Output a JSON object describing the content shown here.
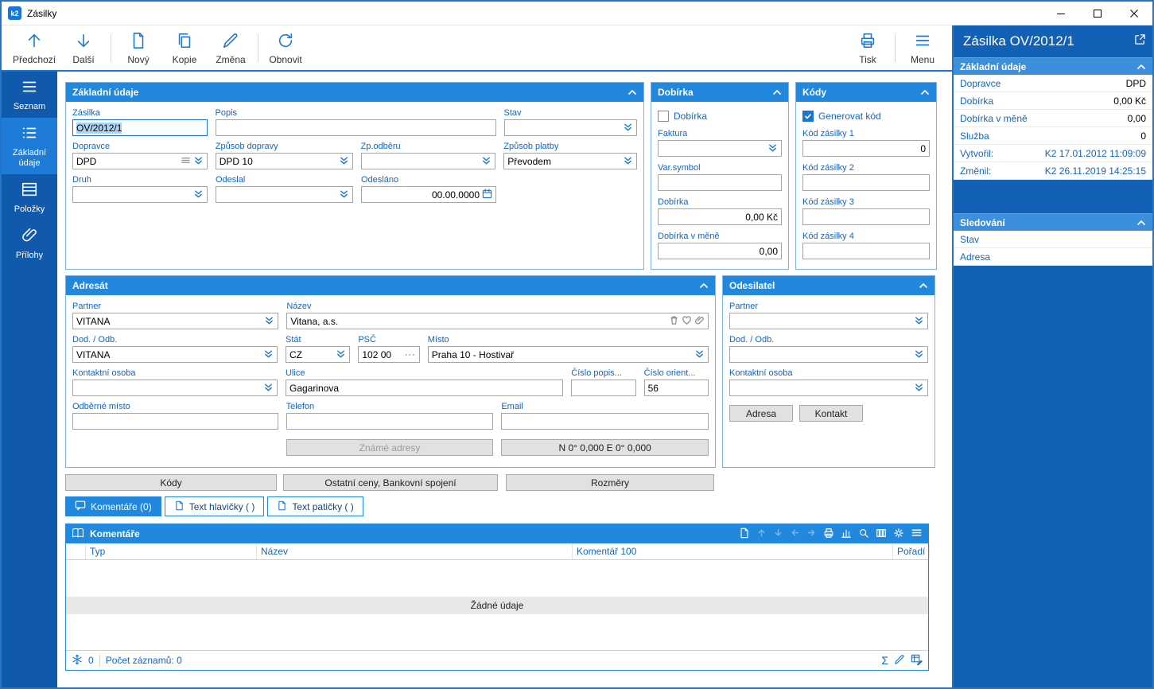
{
  "window": {
    "title": "Zásilky",
    "app_badge": "k2"
  },
  "toolbar": {
    "prev": "Předchozí",
    "next": "Další",
    "new": "Nový",
    "copy": "Kopie",
    "change": "Změna",
    "refresh": "Obnovit",
    "print": "Tisk",
    "menu": "Menu"
  },
  "sidebar": {
    "items": [
      {
        "label": "Seznam"
      },
      {
        "label": "Základní údaje"
      },
      {
        "label": "Položky"
      },
      {
        "label": "Přílohy"
      }
    ]
  },
  "panels": {
    "basic": {
      "title": "Základní údaje",
      "zasilka_label": "Zásilka",
      "zasilka_value": "OV/2012/1",
      "popis_label": "Popis",
      "stav_label": "Stav",
      "dopravce_label": "Dopravce",
      "dopravce_value": "DPD",
      "zpusob_dopravy_label": "Způsob dopravy",
      "zpusob_dopravy_value": "DPD 10",
      "zp_odberu_label": "Zp.odběru",
      "zpusob_platby_label": "Způsob platby",
      "zpusob_platby_value": "Převodem",
      "druh_label": "Druh",
      "odeslal_label": "Odeslal",
      "odeslano_label": "Odesláno",
      "odeslano_value": "00.00.0000"
    },
    "dobirka": {
      "title": "Dobírka",
      "checkbox_label": "Dobírka",
      "faktura_label": "Faktura",
      "var_symbol_label": "Var.symbol",
      "dobirka_label": "Dobírka",
      "dobirka_value": "0,00 Kč",
      "dobirka_v_mene_label": "Dobírka v měně",
      "dobirka_v_mene_value": "0,00"
    },
    "kody": {
      "title": "Kódy",
      "generovat_label": "Generovat kód",
      "kod1_label": "Kód zásilky 1",
      "kod1_value": "0",
      "kod2_label": "Kód zásilky 2",
      "kod3_label": "Kód zásilky 3",
      "kod4_label": "Kód zásilky 4"
    },
    "adresat": {
      "title": "Adresát",
      "partner_label": "Partner",
      "partner_value": "VITANA",
      "nazev_label": "Název",
      "nazev_value": "Vitana, a.s.",
      "dod_odb_label": "Dod. / Odb.",
      "dod_odb_value": "VITANA",
      "stat_label": "Stát",
      "stat_value": "CZ",
      "psc_label": "PSČ",
      "psc_value": "102 00",
      "misto_label": "Místo",
      "misto_value": "Praha 10 - Hostivař",
      "kontaktni_label": "Kontaktní osoba",
      "ulice_label": "Ulice",
      "ulice_value": "Gagarinova",
      "cislo_popis_label": "Číslo popis...",
      "cislo_orient_label": "Číslo orient...",
      "cislo_orient_value": "56",
      "odberne_label": "Odběrné místo",
      "telefon_label": "Telefon",
      "email_label": "Email",
      "zname_adresy_btn": "Známé adresy",
      "gps_btn": "N 0° 0,000 E 0° 0,000"
    },
    "odesilatel": {
      "title": "Odesilatel",
      "partner_label": "Partner",
      "dod_odb_label": "Dod. / Odb.",
      "kontaktni_label": "Kontaktní osoba",
      "adresa_btn": "Adresa",
      "kontakt_btn": "Kontakt"
    }
  },
  "section_buttons": {
    "kody": "Kódy",
    "ostatni": "Ostatní ceny, Bankovní spojení",
    "rozmery": "Rozměry"
  },
  "tabs": [
    {
      "label": "Komentáře (0)"
    },
    {
      "label": "Text hlavičky ( )"
    },
    {
      "label": "Text patičky ( )"
    }
  ],
  "comments": {
    "title": "Komentáře",
    "columns": [
      "Typ",
      "Název",
      "Komentář 100",
      "Pořadí"
    ],
    "empty_text": "Žádné údaje",
    "frozen_count": "0",
    "records_label": "Počet záznamů: 0",
    "sum_icon": "Σ"
  },
  "right_panel": {
    "title": "Zásilka OV/2012/1",
    "basic_title": "Základní údaje",
    "rows": [
      {
        "label": "Dopravce",
        "value": "DPD"
      },
      {
        "label": "Dobírka",
        "value": "0,00 Kč"
      },
      {
        "label": "Dobírka v měně",
        "value": "0,00"
      },
      {
        "label": "Služba",
        "value": "0"
      },
      {
        "label": "Vytvořil:",
        "value": "K2 17.01.2012 11:09:09"
      },
      {
        "label": "Změnil:",
        "value": "K2 26.11.2019 14:25:15"
      }
    ],
    "tracking_title": "Sledování",
    "tracking_rows": [
      {
        "label": "Stav"
      },
      {
        "label": "Adresa"
      }
    ]
  }
}
